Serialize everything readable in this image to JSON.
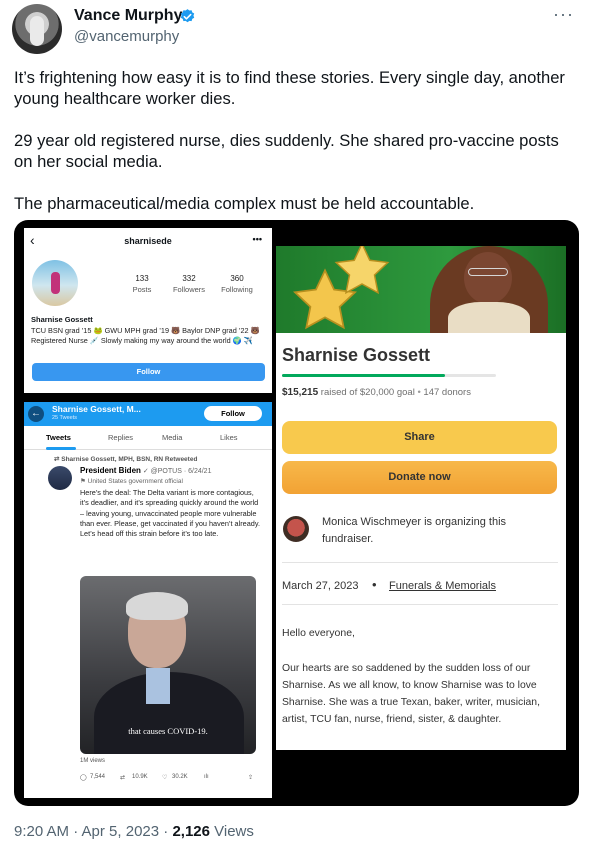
{
  "author": {
    "name": "Vance Murphy",
    "handle": "@vancemurphy",
    "more_icon": "more-horizontal-icon"
  },
  "tweet": {
    "paragraphs": [
      "It’s frightening how easy it is to find these stories. Every single day, another young healthcare worker dies.",
      "29 year old registered nurse, dies suddenly. She shared pro-vaccine posts on her social media.",
      "The pharmaceutical/media complex must be held accountable."
    ],
    "time": "9:20 AM · Apr 5, 2023 · ",
    "views_count": "2,126",
    "views_label": " Views"
  },
  "instagram": {
    "username": "sharnisede",
    "menu": "•••",
    "back": "‹",
    "posts_count": "133",
    "posts_label": "Posts",
    "followers_count": "332",
    "followers_label": "Followers",
    "following_count": "360",
    "following_label": "Following",
    "name": "Sharnise Gossett",
    "bio": "TCU BSN grad ’15 🐸 GWU MPH grad ’19 🐻 Baylor DNP grad ’22 🐻 Registered Nurse 💉 Slowly making my way around the world 🌍 ✈️",
    "follow_label": "Follow"
  },
  "twitter_panel": {
    "back": "←",
    "name": "Sharnise Gossett, M...",
    "tweet_count": "25 Tweets",
    "follow_label": "Follow",
    "tabs": [
      "Tweets",
      "Replies",
      "Media",
      "Likes"
    ],
    "retweeted_by": "⇄ Sharnise Gossett, MPH, BSN, RN Retweeted",
    "retweet_name": "President Biden",
    "retweet_meta": " ✓ @POTUS · 6/24/21",
    "official": "⚑ United States government official",
    "retweet_text": "Here’s the deal: The Delta variant is more contagious, it’s deadlier, and it’s spreading quickly around the world – leaving young, unvaccinated people more vulnerable than ever. Please, get vaccinated if you haven’t already. Let’s head off this strain before it’s too late.",
    "video_caption": "that causes COVID-19.",
    "views": "1M views",
    "replies": "7,544",
    "retweets": "10.9K",
    "likes": "30.2K"
  },
  "gofundme": {
    "name": "Sharnise Gossett",
    "progress_fraction": 0.76,
    "raised_amount": "$15,215",
    "raised_text": " raised of $20,000 goal ",
    "donors": "147 donors",
    "share_label": "Share",
    "donate_label": "Donate now",
    "organizer": "Monica Wischmeyer is organizing this fundraiser.",
    "date": "March 27, 2023",
    "category": "Funerals & Memorials",
    "greeting": "Hello everyone,",
    "story": "Our hearts are so saddened by the sudden loss of our Sharnise. As we all know, to know Sharnise was to love Sharnise. She was a true Texan, baker, writer, musician, artist, TCU fan, nurse, friend, sister, & daughter."
  },
  "colors": {
    "twitter_blue": "#1d9bf0",
    "gofundme_green": "#02a95c",
    "share_yellow": "#f8c94d",
    "donate_orange": "#f2a234"
  }
}
